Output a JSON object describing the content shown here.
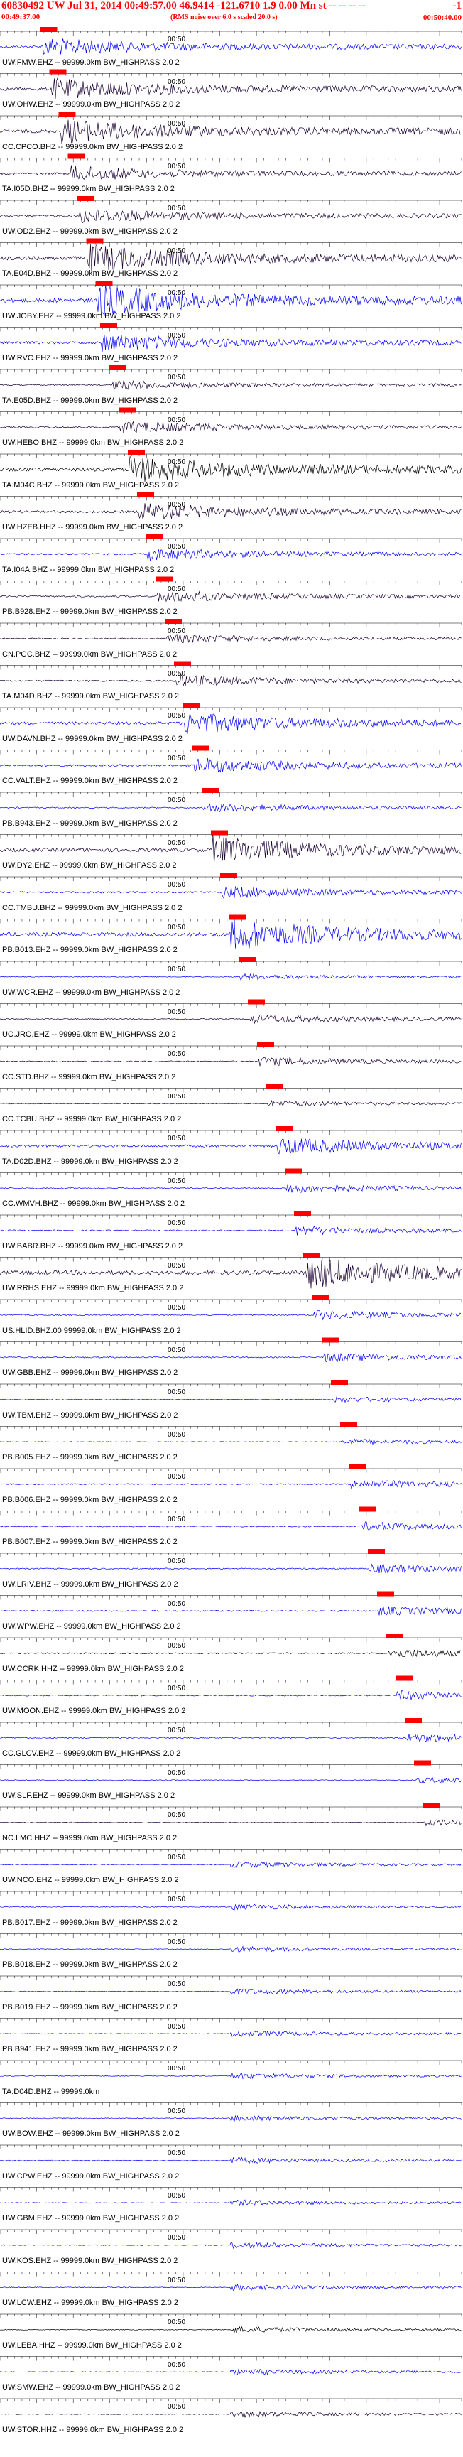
{
  "header": {
    "title": "60830492 UW Jul 31, 2014 00:49:57.00   46.9414  -121.6710   1.9  0.00  Mn  st -- -- -- --",
    "right_mark": "-1",
    "start_time": "00:49:37.00",
    "subtitle": "(RMS noise over 6.0 s scaled 20.0 s)",
    "end_time": "00:50:40.00"
  },
  "tick_label": "00:50",
  "colors": {
    "blue": "#0000ff",
    "dark": "#1a0033",
    "black": "#000000",
    "pick": "#ff0000"
  },
  "stations": [
    {
      "label": "UW.FMW.EHZ -- 99999.0km BW_HIGHPASS  2.0  2",
      "color": "#0000ff",
      "amp": 0.6,
      "pick": 0.09
    },
    {
      "label": "UW.OHW.EHZ -- 99999.0km BW_HIGHPASS  2.0  2",
      "color": "#1a0033",
      "amp": 0.7,
      "pick": 0.11
    },
    {
      "label": "CC.CPCO.BHZ -- 99999.0km BW_HIGHPASS  2.0  2",
      "color": "#1a0033",
      "amp": 0.8,
      "pick": 0.13
    },
    {
      "label": "TA.I05D.BHZ -- 99999.0km BW_HIGHPASS  2.0  2",
      "color": "#1a0033",
      "amp": 0.5,
      "pick": 0.15
    },
    {
      "label": "UW.OD2.EHZ -- 99999.0km BW_HIGHPASS  2.0  2",
      "color": "#1a0033",
      "amp": 0.5,
      "pick": 0.17
    },
    {
      "label": "TA.E04D.BHZ -- 99999.0km BW_HIGHPASS  2.0  2",
      "color": "#1a0033",
      "amp": 0.9,
      "pick": 0.19
    },
    {
      "label": "UW.JOBY.EHZ -- 99999.0km BW_HIGHPASS  2.0  2",
      "color": "#0000ff",
      "amp": 1.0,
      "pick": 0.21
    },
    {
      "label": "UW.RVC.EHZ -- 99999.0km BW_HIGHPASS  2.0  2",
      "color": "#0000ff",
      "amp": 0.6,
      "pick": 0.22
    },
    {
      "label": "TA.E05D.BHZ -- 99999.0km BW_HIGHPASS  2.0  2",
      "color": "#1a0033",
      "amp": 0.3,
      "pick": 0.24
    },
    {
      "label": "UW.HEBO.BHZ -- 99999.0km BW_HIGHPASS  2.0  2",
      "color": "#1a0033",
      "amp": 0.4,
      "pick": 0.26
    },
    {
      "label": "TA.M04C.BHZ -- 99999.0km BW_HIGHPASS  2.0  2",
      "color": "#000000",
      "amp": 0.9,
      "pick": 0.28
    },
    {
      "label": "UW.HZEB.HHZ -- 99999.0km BW_HIGHPASS  2.0  2",
      "color": "#1a0033",
      "amp": 0.6,
      "pick": 0.3
    },
    {
      "label": "TA.I04A.BHZ -- 99999.0km BW_HIGHPASS  2.0  2",
      "color": "#0000ff",
      "amp": 0.4,
      "pick": 0.32
    },
    {
      "label": "PB.B928.EHZ -- 99999.0km BW_HIGHPASS  2.0  2",
      "color": "#1a0033",
      "amp": 0.4,
      "pick": 0.34
    },
    {
      "label": "CN.PGC.BHZ -- 99999.0km BW_HIGHPASS  2.0  2",
      "color": "#1a0033",
      "amp": 0.3,
      "pick": 0.36
    },
    {
      "label": "TA.M04D.BHZ -- 99999.0km BW_HIGHPASS  2.0  2",
      "color": "#1a0033",
      "amp": 0.4,
      "pick": 0.38
    },
    {
      "label": "UW.DAVN.BHZ -- 99999.0km BW_HIGHPASS  2.0  2",
      "color": "#0000ff",
      "amp": 0.7,
      "pick": 0.4
    },
    {
      "label": "CC.VALT.EHZ -- 99999.0km BW_HIGHPASS  2.0  2",
      "color": "#0000ff",
      "amp": 0.5,
      "pick": 0.42
    },
    {
      "label": "PB.B943.EHZ -- 99999.0km BW_HIGHPASS  2.0  2",
      "color": "#0000ff",
      "amp": 0.3,
      "pick": 0.44
    },
    {
      "label": "UW.DY2.EHZ -- 99999.0km BW_HIGHPASS  2.0  2",
      "color": "#1a0033",
      "amp": 0.9,
      "pick": 0.46
    },
    {
      "label": "CC.TMBU.BHZ -- 99999.0km BW_HIGHPASS  2.0  2",
      "color": "#0000ff",
      "amp": 0.4,
      "pick": 0.48
    },
    {
      "label": "PB.B013.EHZ -- 99999.0km BW_HIGHPASS  2.0  2",
      "color": "#0000ff",
      "amp": 1.0,
      "pick": 0.5
    },
    {
      "label": "UW.WCR.EHZ -- 99999.0km BW_HIGHPASS  2.0  2",
      "color": "#0000ff",
      "amp": 0.2,
      "pick": 0.52
    },
    {
      "label": "UO.JRO.EHZ -- 99999.0km BW_HIGHPASS  2.0  2",
      "color": "#1a0033",
      "amp": 0.3,
      "pick": 0.54
    },
    {
      "label": "CC.STD.BHZ -- 99999.0km BW_HIGHPASS  2.0  2",
      "color": "#1a0033",
      "amp": 0.3,
      "pick": 0.56
    },
    {
      "label": "CC.TCBU.BHZ -- 99999.0km BW_HIGHPASS  2.0  2",
      "color": "#1a0033",
      "amp": 0.2,
      "pick": 0.58
    },
    {
      "label": "TA.D02D.BHZ -- 99999.0km BW_HIGHPASS  2.0  2",
      "color": "#0000ff",
      "amp": 0.6,
      "pick": 0.6
    },
    {
      "label": "CC.WMVH.BHZ -- 99999.0km BW_HIGHPASS  2.0  2",
      "color": "#0000ff",
      "amp": 0.3,
      "pick": 0.62
    },
    {
      "label": "UW.BABR.BHZ -- 99999.0km BW_HIGHPASS  2.0  2",
      "color": "#0000ff",
      "amp": 0.3,
      "pick": 0.64
    },
    {
      "label": "UW.RRHS.EHZ -- 99999.0km BW_HIGHPASS  2.0  2",
      "color": "#1a0033",
      "amp": 1.0,
      "pick": 0.66
    },
    {
      "label": "US.HLID.BHZ.00 99999.0km BW_HIGHPASS  2.0  2",
      "color": "#0000ff",
      "amp": 0.3,
      "pick": 0.68
    },
    {
      "label": "UW.GBB.EHZ -- 99999.0km BW_HIGHPASS  2.0  2",
      "color": "#0000ff",
      "amp": 0.3,
      "pick": 0.7
    },
    {
      "label": "UW.TBM.EHZ -- 99999.0km BW_HIGHPASS  2.0  2",
      "color": "#0000ff",
      "amp": 0.2,
      "pick": 0.72
    },
    {
      "label": "PB.B005.EHZ -- 99999.0km BW_HIGHPASS  2.0  2",
      "color": "#0000ff",
      "amp": 0.2,
      "pick": 0.74
    },
    {
      "label": "PB.B006.EHZ -- 99999.0km BW_HIGHPASS  2.0  2",
      "color": "#0000ff",
      "amp": 0.3,
      "pick": 0.76
    },
    {
      "label": "PB.B007.EHZ -- 99999.0km BW_HIGHPASS  2.0  2",
      "color": "#0000ff",
      "amp": 0.3,
      "pick": 0.78
    },
    {
      "label": "UW.LRIV.BHZ -- 99999.0km BW_HIGHPASS  2.0  2",
      "color": "#0000ff",
      "amp": 0.3,
      "pick": 0.8
    },
    {
      "label": "UW.WPW.EHZ -- 99999.0km BW_HIGHPASS  2.0  2",
      "color": "#0000ff",
      "amp": 0.3,
      "pick": 0.82
    },
    {
      "label": "UW.CCRK.HHZ -- 99999.0km BW_HIGHPASS  2.0  2",
      "color": "#000000",
      "amp": 0.3,
      "pick": 0.84
    },
    {
      "label": "UW.MOON.EHZ -- 99999.0km BW_HIGHPASS  2.0  2",
      "color": "#0000ff",
      "amp": 0.3,
      "pick": 0.86
    },
    {
      "label": "CC.GLCV.EHZ -- 99999.0km BW_HIGHPASS  2.0  2",
      "color": "#0000ff",
      "amp": 0.3,
      "pick": 0.88
    },
    {
      "label": "UW.SLF.EHZ -- 99999.0km BW_HIGHPASS  2.0  2",
      "color": "#0000ff",
      "amp": 0.2,
      "pick": 0.9
    },
    {
      "label": "NC.LMC.HHZ -- 99999.0km BW_HIGHPASS  2.0  2",
      "color": "#1a0033",
      "amp": 0.2,
      "pick": 0.92
    },
    {
      "label": "UW.NCO.EHZ -- 99999.0km BW_HIGHPASS  2.0  2",
      "color": "#0000ff",
      "amp": 0.2,
      "pick": null
    },
    {
      "label": "PB.B017.EHZ -- 99999.0km BW_HIGHPASS  2.0  2",
      "color": "#0000ff",
      "amp": 0.2,
      "pick": null
    },
    {
      "label": "PB.B018.EHZ -- 99999.0km BW_HIGHPASS  2.0  2",
      "color": "#0000ff",
      "amp": 0.2,
      "pick": null
    },
    {
      "label": "PB.B019.EHZ -- 99999.0km BW_HIGHPASS  2.0  2",
      "color": "#0000ff",
      "amp": 0.2,
      "pick": null
    },
    {
      "label": "PB.B941.EHZ -- 99999.0km BW_HIGHPASS  2.0  2",
      "color": "#0000ff",
      "amp": 0.2,
      "pick": null
    },
    {
      "label": "TA.D04D.BHZ -- 99999.0km",
      "color": "#0000ff",
      "amp": 0.2,
      "pick": null
    },
    {
      "label": "UW.BOW.EHZ -- 99999.0km BW_HIGHPASS  2.0  2",
      "color": "#0000ff",
      "amp": 0.2,
      "pick": null
    },
    {
      "label": "UW.CPW.EHZ -- 99999.0km BW_HIGHPASS  2.0  2",
      "color": "#0000ff",
      "amp": 0.2,
      "pick": null
    },
    {
      "label": "UW.GBM.EHZ -- 99999.0km BW_HIGHPASS  2.0  2",
      "color": "#0000ff",
      "amp": 0.2,
      "pick": null
    },
    {
      "label": "UW.KOS.EHZ -- 99999.0km BW_HIGHPASS  2.0  2",
      "color": "#0000ff",
      "amp": 0.2,
      "pick": null
    },
    {
      "label": "UW.LCW.EHZ -- 99999.0km BW_HIGHPASS  2.0  2",
      "color": "#0000ff",
      "amp": 0.2,
      "pick": null
    },
    {
      "label": "UW.LEBA.HHZ -- 99999.0km BW_HIGHPASS  2.0  2",
      "color": "#000000",
      "amp": 0.2,
      "pick": null
    },
    {
      "label": "UW.SMW.EHZ -- 99999.0km BW_HIGHPASS  2.0  2",
      "color": "#0000ff",
      "amp": 0.2,
      "pick": null
    },
    {
      "label": "UW.STOR.HHZ -- 99999.0km BW_HIGHPASS  2.0  2",
      "color": "#1a0033",
      "amp": 0.2,
      "pick": null
    }
  ]
}
